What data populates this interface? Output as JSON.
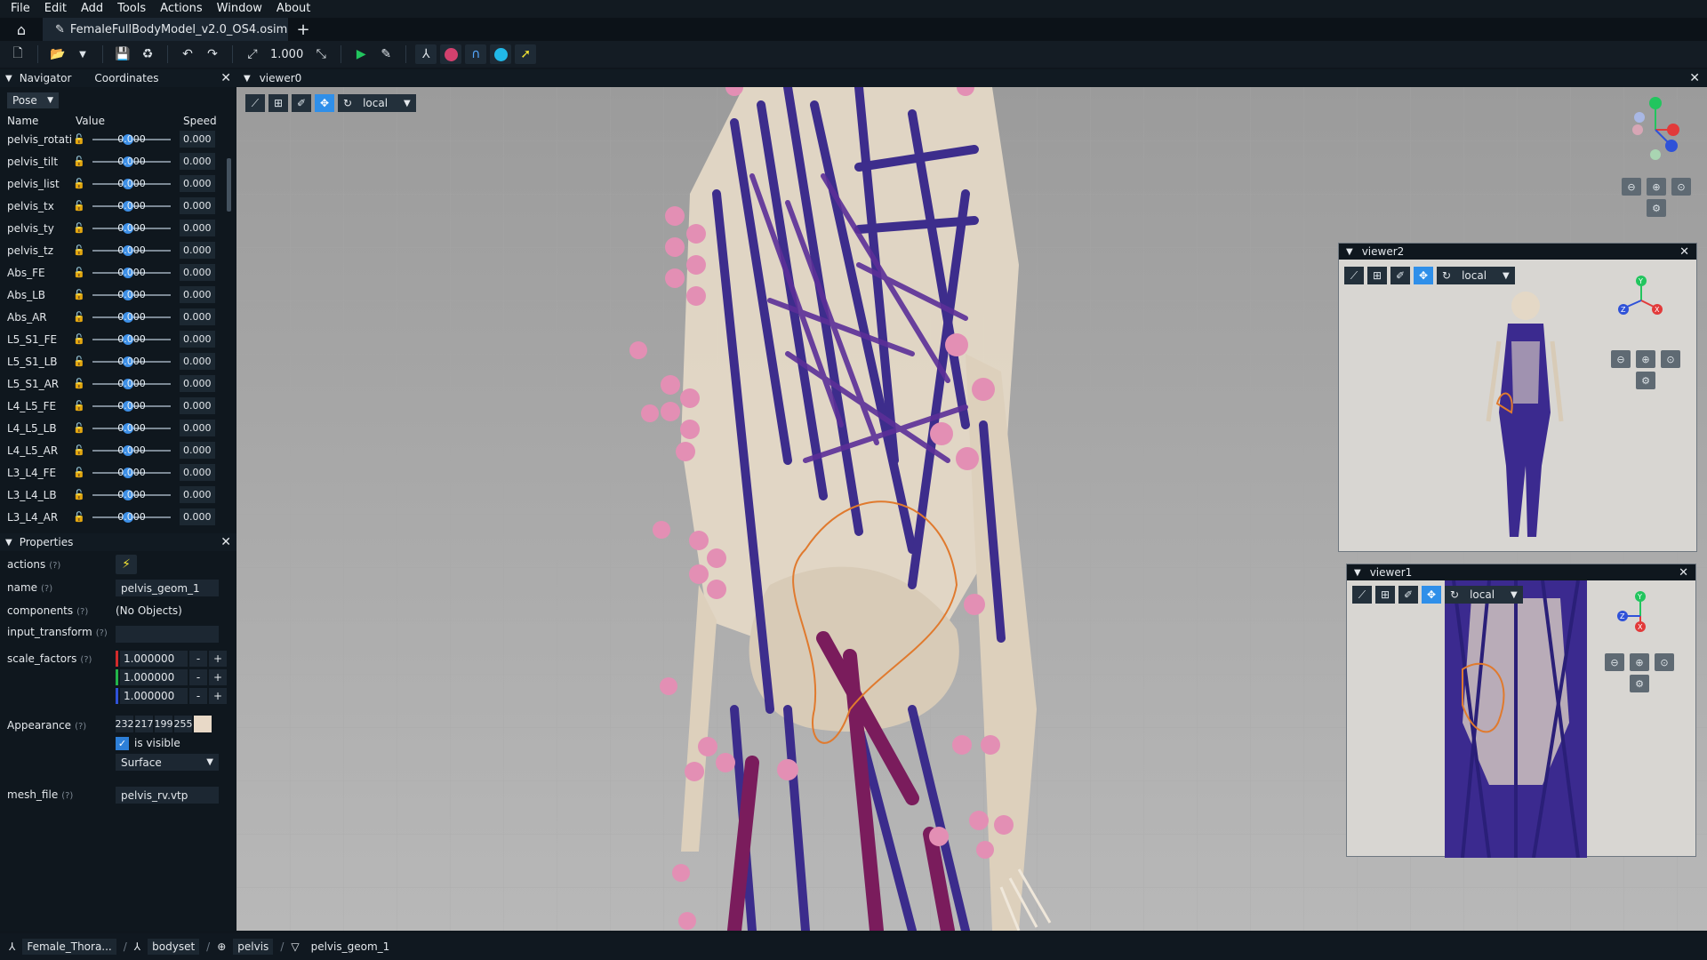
{
  "menu": [
    "File",
    "Edit",
    "Add",
    "Tools",
    "Actions",
    "Window",
    "About"
  ],
  "tab": {
    "title": "FemaleFullBodyModel_v2.0_OS4.osim",
    "new_tab": "+"
  },
  "toolbar": {
    "scale_value": "1.000"
  },
  "navigator": {
    "tabs": [
      "Navigator",
      "Coordinates"
    ],
    "pose_label": "Pose",
    "columns": [
      "Name",
      "Value",
      "Speed"
    ],
    "rows": [
      {
        "name": "pelvis_rotati",
        "value": "0.000",
        "speed": "0.000"
      },
      {
        "name": "pelvis_tilt",
        "value": "0.000",
        "speed": "0.000"
      },
      {
        "name": "pelvis_list",
        "value": "0.000",
        "speed": "0.000"
      },
      {
        "name": "pelvis_tx",
        "value": "0.000",
        "speed": "0.000"
      },
      {
        "name": "pelvis_ty",
        "value": "0.000",
        "speed": "0.000"
      },
      {
        "name": "pelvis_tz",
        "value": "0.000",
        "speed": "0.000"
      },
      {
        "name": "Abs_FE",
        "value": "0.000",
        "speed": "0.000"
      },
      {
        "name": "Abs_LB",
        "value": "0.000",
        "speed": "0.000"
      },
      {
        "name": "Abs_AR",
        "value": "0.000",
        "speed": "0.000"
      },
      {
        "name": "L5_S1_FE",
        "value": "0.000",
        "speed": "0.000"
      },
      {
        "name": "L5_S1_LB",
        "value": "0.000",
        "speed": "0.000"
      },
      {
        "name": "L5_S1_AR",
        "value": "0.000",
        "speed": "0.000"
      },
      {
        "name": "L4_L5_FE",
        "value": "0.000",
        "speed": "0.000"
      },
      {
        "name": "L4_L5_LB",
        "value": "0.000",
        "speed": "0.000"
      },
      {
        "name": "L4_L5_AR",
        "value": "0.000",
        "speed": "0.000"
      },
      {
        "name": "L3_L4_FE",
        "value": "0.000",
        "speed": "0.000"
      },
      {
        "name": "L3_L4_LB",
        "value": "0.000",
        "speed": "0.000"
      },
      {
        "name": "L3_L4_AR",
        "value": "0.000",
        "speed": "0.000"
      }
    ]
  },
  "properties": {
    "title": "Properties",
    "help": "(?)",
    "actions_label": "actions",
    "name_label": "name",
    "name_value": "pelvis_geom_1",
    "components_label": "components",
    "components_value": "(No Objects)",
    "input_transform_label": "input_transform",
    "scale_factors_label": "scale_factors",
    "scale_factors": [
      "1.000000",
      "1.000000",
      "1.000000"
    ],
    "appearance_label": "Appearance",
    "appearance_rgba": [
      "232",
      "217",
      "199",
      "255"
    ],
    "is_visible_label": "is visible",
    "representation": "Surface",
    "mesh_file_label": "mesh_file",
    "mesh_file_value": "pelvis_rv.vtp"
  },
  "viewers": {
    "main": "viewer0",
    "second": "viewer2",
    "third": "viewer1",
    "frame_label": "local",
    "axes": {
      "x": "X",
      "y": "Y",
      "z": "Z"
    }
  },
  "statusbar": [
    "Female_Thora...",
    "bodyset",
    "pelvis",
    "pelvis_geom_1"
  ],
  "colors": {
    "accent": "#2f8fe9",
    "muscle": "#3b2a8f",
    "bone": "#e8d9c7",
    "marker": "#e38fb4"
  }
}
